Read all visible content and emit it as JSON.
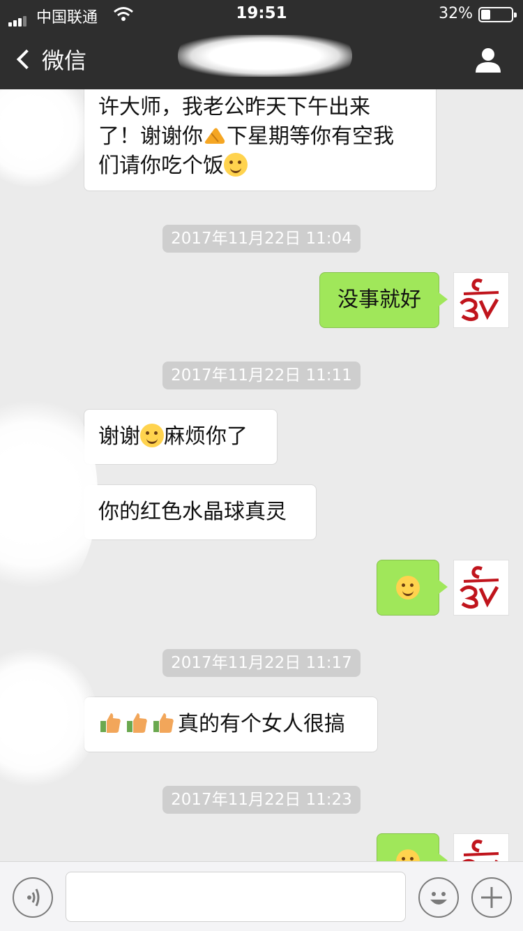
{
  "status_bar": {
    "carrier": "中国联通",
    "time": "19:51",
    "battery_percent_label": "32%",
    "battery_level": 0.32
  },
  "nav": {
    "back_label": "微信",
    "title": ""
  },
  "messages": {
    "m1_line1": "许大师，我老公昨天下午出来",
    "m1_line2a": "了！谢谢你",
    "m1_line2b": "下星期等你有空我",
    "m1_line3": "们请你吃个饭",
    "ts1": "2017年11月22日 11:04",
    "m2": "没事就好",
    "ts2": "2017年11月22日 11:11",
    "m3a": "谢谢",
    "m3b": "麻烦你了",
    "m4": "你的红色水晶球真灵",
    "ts3": "2017年11月22日 11:17",
    "m6": "真的有个女人很搞",
    "ts4": "2017年11月22日 11:23"
  },
  "input": {
    "placeholder": ""
  },
  "colors": {
    "nav_bg": "#2e2e2e",
    "chat_bg": "#ebebeb",
    "bubble_sent": "#a0e75a",
    "bubble_received": "#ffffff",
    "timestamp_bg": "#cecece",
    "avatar_red": "#c0141c"
  },
  "icons": {
    "back": "chevron-left-icon",
    "profile": "person-icon",
    "voice": "voice-icon",
    "emoji": "emoji-face-icon",
    "more": "plus-icon",
    "smile": "smiley-emoji-icon",
    "thumbs_up": "thumbs-up-emoji-icon",
    "hand": "hand-emoji-icon"
  }
}
